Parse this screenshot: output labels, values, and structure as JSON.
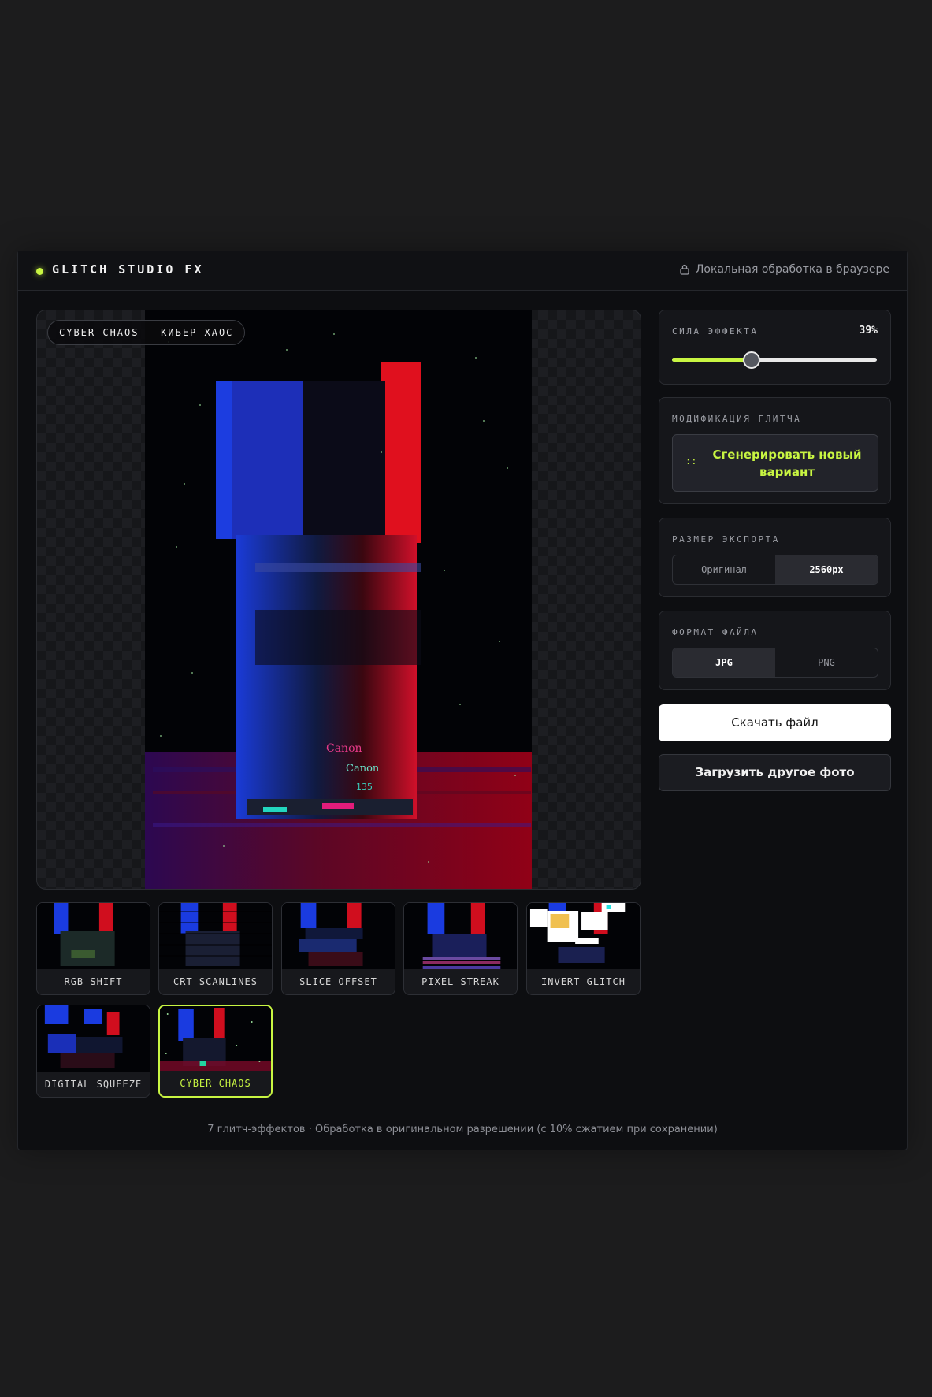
{
  "header": {
    "brand": "GLITCH STUDIO FX",
    "local_note": "Локальная обработка в браузере",
    "icons": {
      "status": "status-dot",
      "lock": "lock-icon"
    }
  },
  "preview": {
    "effect_label": "CYBER CHAOS — КИБЕР ХАОС"
  },
  "effects": [
    {
      "label": "RGB SHIFT",
      "active": false
    },
    {
      "label": "CRT SCANLINES",
      "active": false
    },
    {
      "label": "SLICE OFFSET",
      "active": false
    },
    {
      "label": "PIXEL STREAK",
      "active": false
    },
    {
      "label": "INVERT GLITCH",
      "active": false
    },
    {
      "label": "DIGITAL SQUEEZE",
      "active": false
    },
    {
      "label": "CYBER CHAOS",
      "active": true
    }
  ],
  "strength": {
    "title": "СИЛА ЭФФЕКТА",
    "value_text": "39%",
    "value": 0.39
  },
  "modify": {
    "title": "МОДИФИКАЦИЯ ГЛИТЧА",
    "icon": "::",
    "button": "Сгенерировать новый вариант"
  },
  "export_size": {
    "title": "РАЗМЕР ЭКСПОРТА",
    "options": [
      "Оригинал",
      "2560px"
    ],
    "selected": "2560px"
  },
  "file_format": {
    "title": "ФОРМАТ ФАЙЛА",
    "options": [
      "JPG",
      "PNG"
    ],
    "selected": "JPG"
  },
  "actions": {
    "download": "Скачать файл",
    "upload": "Загрузить другое фото"
  },
  "footer": "7 глитч-эффектов · Обработка в оригинальном разрешении (с 10% сжатием при сохранении)",
  "colors": {
    "accent": "#c8f542",
    "background": "#1c1c1d",
    "panel": "#15161a"
  }
}
